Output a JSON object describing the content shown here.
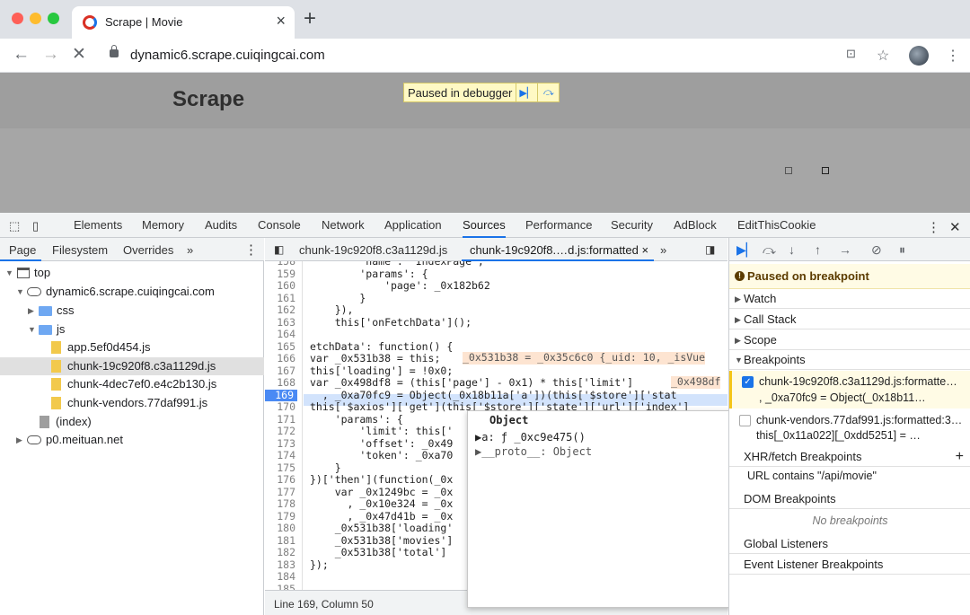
{
  "browser": {
    "tab_title": "Scrape | Movie",
    "url": "dynamic6.scrape.cuiqingcai.com"
  },
  "page": {
    "brand": "Scrape",
    "paused_label": "Paused in debugger"
  },
  "devtools": {
    "tabs": [
      "Elements",
      "Memory",
      "Audits",
      "Console",
      "Network",
      "Application",
      "Sources",
      "Performance",
      "Security",
      "AdBlock",
      "EditThisCookie"
    ],
    "active_tab": "Sources"
  },
  "navigator": {
    "tabs": [
      "Page",
      "Filesystem",
      "Overrides"
    ],
    "more": "»",
    "tree": [
      {
        "label": "top",
        "type": "frame",
        "depth": 0
      },
      {
        "label": "dynamic6.scrape.cuiqingcai.com",
        "type": "domain",
        "depth": 1
      },
      {
        "label": "css",
        "type": "folder",
        "depth": 2
      },
      {
        "label": "js",
        "type": "folder",
        "depth": 2
      },
      {
        "label": "app.5ef0d454.js",
        "type": "file",
        "depth": 3
      },
      {
        "label": "chunk-19c920f8.c3a1129d.js",
        "type": "file",
        "depth": 3,
        "selected": true
      },
      {
        "label": "chunk-4dec7ef0.e4c2b130.js",
        "type": "file",
        "depth": 3
      },
      {
        "label": "chunk-vendors.77daf991.js",
        "type": "file",
        "depth": 3
      },
      {
        "label": "(index)",
        "type": "file-grey",
        "depth": 2
      },
      {
        "label": "p0.meituan.net",
        "type": "domain",
        "depth": 1
      }
    ]
  },
  "editor": {
    "tabs": [
      "chunk-19c920f8.c3a1129d.js",
      "chunk-19c920f8.…d.js:formatted ×"
    ],
    "more": "»",
    "current_line": "169",
    "status": "Line 169, Column 50",
    "lines": [
      {
        "n": "158",
        "t": "        'name': 'IndexPage',"
      },
      {
        "n": "159",
        "t": "        'params': {"
      },
      {
        "n": "160",
        "t": "            'page': _0x182b62"
      },
      {
        "n": "161",
        "t": "        }"
      },
      {
        "n": "162",
        "t": "    }),"
      },
      {
        "n": "163",
        "t": "    this['onFetchData']();"
      },
      {
        "n": "164",
        "t": ""
      },
      {
        "n": "165",
        "t": "etchData': function() {"
      },
      {
        "n": "166",
        "t": "var _0x531b38 = this;"
      },
      {
        "n": "167",
        "t": "this['loading'] = !0x0;"
      },
      {
        "n": "168",
        "t": "var _0x498df8 = (this['page'] - 0x1) * this['limit']"
      },
      {
        "n": "169",
        "t": "  , _0xa70fc9 = Object(_0x18b11a['a'])(this['$store']['stat"
      },
      {
        "n": "170",
        "t": "this['$axios']['get'](this['$store']['state']['url']['index']"
      },
      {
        "n": "171",
        "t": "    'params': {"
      },
      {
        "n": "172",
        "t": "        'limit': this['"
      },
      {
        "n": "173",
        "t": "        'offset': _0x49"
      },
      {
        "n": "174",
        "t": "        'token': _0xa70"
      },
      {
        "n": "175",
        "t": "    }"
      },
      {
        "n": "176",
        "t": "})['then'](function(_0x"
      },
      {
        "n": "177",
        "t": "    var _0x1249bc = _0x"
      },
      {
        "n": "178",
        "t": "      , _0x10e324 = _0x"
      },
      {
        "n": "179",
        "t": "      , _0x47d41b = _0x"
      },
      {
        "n": "180",
        "t": "    _0x531b38['loading'"
      },
      {
        "n": "181",
        "t": "    _0x531b38['movies']"
      },
      {
        "n": "182",
        "t": "    _0x531b38['total']"
      },
      {
        "n": "183",
        "t": "});"
      },
      {
        "n": "184",
        "t": ""
      },
      {
        "n": "185",
        "t": ""
      }
    ],
    "inline_166": "_0x531b38 = _0x35c6c0 {_uid: 10, _isVue",
    "inline_168": "_0x498df",
    "popup": {
      "title": "Object",
      "rows": [
        "▶a: ƒ _0xc9e475()",
        "▶__proto__: Object"
      ]
    }
  },
  "sidebar": {
    "paused": "Paused on breakpoint",
    "sections": [
      "Watch",
      "Call Stack",
      "Scope",
      "Breakpoints"
    ],
    "breakpoints": [
      {
        "file": "chunk-19c920f8.c3a1129d.js:formatte…",
        "code": ", _0xa70fc9 = Object(_0x18b11…",
        "checked": true
      },
      {
        "file": "chunk-vendors.77daf991.js:formatted:3…",
        "code": "this[_0x11a022][_0xdd5251] = …",
        "checked": false
      }
    ],
    "xhr_title": "XHR/fetch Breakpoints",
    "xhr_item": "URL contains \"/api/movie\"",
    "dom_title": "DOM Breakpoints",
    "dom_empty": "No breakpoints",
    "global": "Global Listeners",
    "event": "Event Listener Breakpoints"
  }
}
